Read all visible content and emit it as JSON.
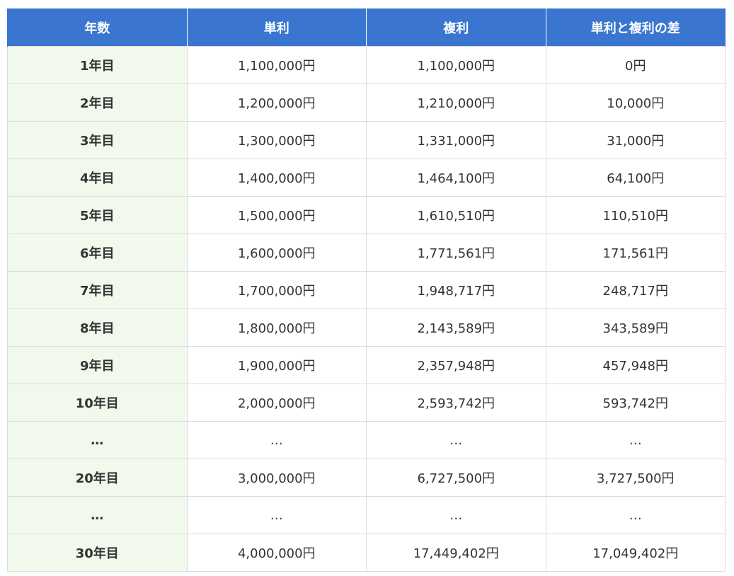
{
  "table": {
    "headers": [
      "年数",
      "単利",
      "複利",
      "単利と複利の差"
    ],
    "rows": [
      [
        "1年目",
        "1,100,000円",
        "1,100,000円",
        "0円"
      ],
      [
        "2年目",
        "1,200,000円",
        "1,210,000円",
        "10,000円"
      ],
      [
        "3年目",
        "1,300,000円",
        "1,331,000円",
        "31,000円"
      ],
      [
        "4年目",
        "1,400,000円",
        "1,464,100円",
        "64,100円"
      ],
      [
        "5年目",
        "1,500,000円",
        "1,610,510円",
        "110,510円"
      ],
      [
        "6年目",
        "1,600,000円",
        "1,771,561円",
        "171,561円"
      ],
      [
        "7年目",
        "1,700,000円",
        "1,948,717円",
        "248,717円"
      ],
      [
        "8年目",
        "1,800,000円",
        "2,143,589円",
        "343,589円"
      ],
      [
        "9年目",
        "1,900,000円",
        "2,357,948円",
        "457,948円"
      ],
      [
        "10年目",
        "2,000,000円",
        "2,593,742円",
        "593,742円"
      ],
      [
        "…",
        "…",
        "…",
        "…"
      ],
      [
        "20年目",
        "3,000,000円",
        "6,727,500円",
        "3,727,500円"
      ],
      [
        "…",
        "…",
        "…",
        "…"
      ],
      [
        "30年目",
        "4,000,000円",
        "17,449,402円",
        "17,049,402円"
      ]
    ]
  },
  "colors": {
    "header_bg": "#3a75d0",
    "header_text": "#ffffff",
    "year_column_bg": "#f0f9ec",
    "border": "#dcdcdc"
  }
}
